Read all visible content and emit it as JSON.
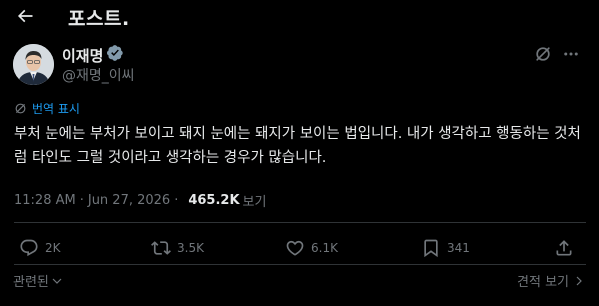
{
  "header": {
    "title": "포스트."
  },
  "author": {
    "name": "이재명",
    "handle": "@재명_이씨"
  },
  "translate": {
    "label": "번역 표시"
  },
  "post": {
    "text": "부처 눈에는 부처가 보이고 돼지 눈에는 돼지가 보이는 법입니다. 내가 생각하고 행동하는 것처럼 타인도 그럴 것이라고 생각하는 경우가 많습니다."
  },
  "meta": {
    "time": "11:28 AM",
    "separator": "·",
    "date": "Jun 27, 2026",
    "views_count": "465.2K",
    "views_label": "보기"
  },
  "actions": {
    "replies": "2K",
    "reposts": "3.5K",
    "likes": "6.1K",
    "bookmarks": "341"
  },
  "footer": {
    "related": "관련된",
    "quotes": "견적 보기"
  },
  "colors": {
    "background": "#000000",
    "text": "#e7e9ea",
    "muted": "#71767b",
    "accent": "#1d9bf0",
    "divider": "#2f3336",
    "verified": "#829aab"
  }
}
